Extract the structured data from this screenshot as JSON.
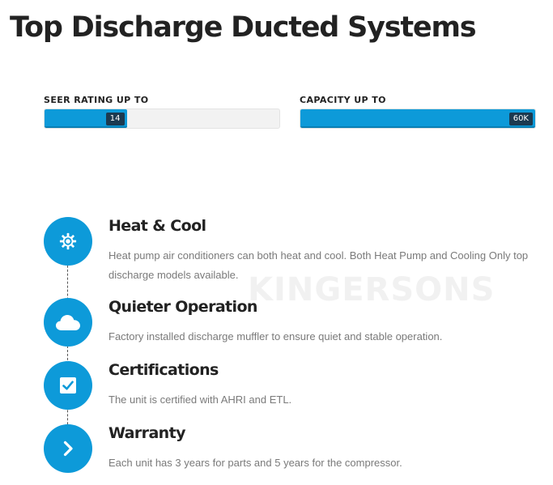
{
  "page": {
    "title": "Top Discharge Ducted Systems"
  },
  "metrics": {
    "seer": {
      "label": "SEER RATING UP TO",
      "value": "14",
      "fill_fraction": 0.35
    },
    "capacity": {
      "label": "CAPACITY UP TO",
      "value": "60K",
      "fill_fraction": 1.0
    }
  },
  "watermark": "KINGERSONS",
  "features": [
    {
      "icon": "gear-icon",
      "title": "Heat & Cool",
      "description": "Heat pump air conditioners can both heat and cool. Both Heat Pump and Cooling Only top discharge models available."
    },
    {
      "icon": "cloud-icon",
      "title": "Quieter Operation",
      "description": "Factory installed discharge muffler to ensure quiet and stable operation."
    },
    {
      "icon": "checkbox-icon",
      "title": "Certifications",
      "description": "The unit is certified with AHRI and ETL."
    },
    {
      "icon": "chevron-right-icon",
      "title": "Warranty",
      "description": "Each unit has 3 years for parts and 5 years for the compressor."
    }
  ],
  "colors": {
    "accent": "#0d9ad9",
    "value_badge": "#1c3a50",
    "title_text": "#222222",
    "body_text": "#7a7a7a"
  }
}
